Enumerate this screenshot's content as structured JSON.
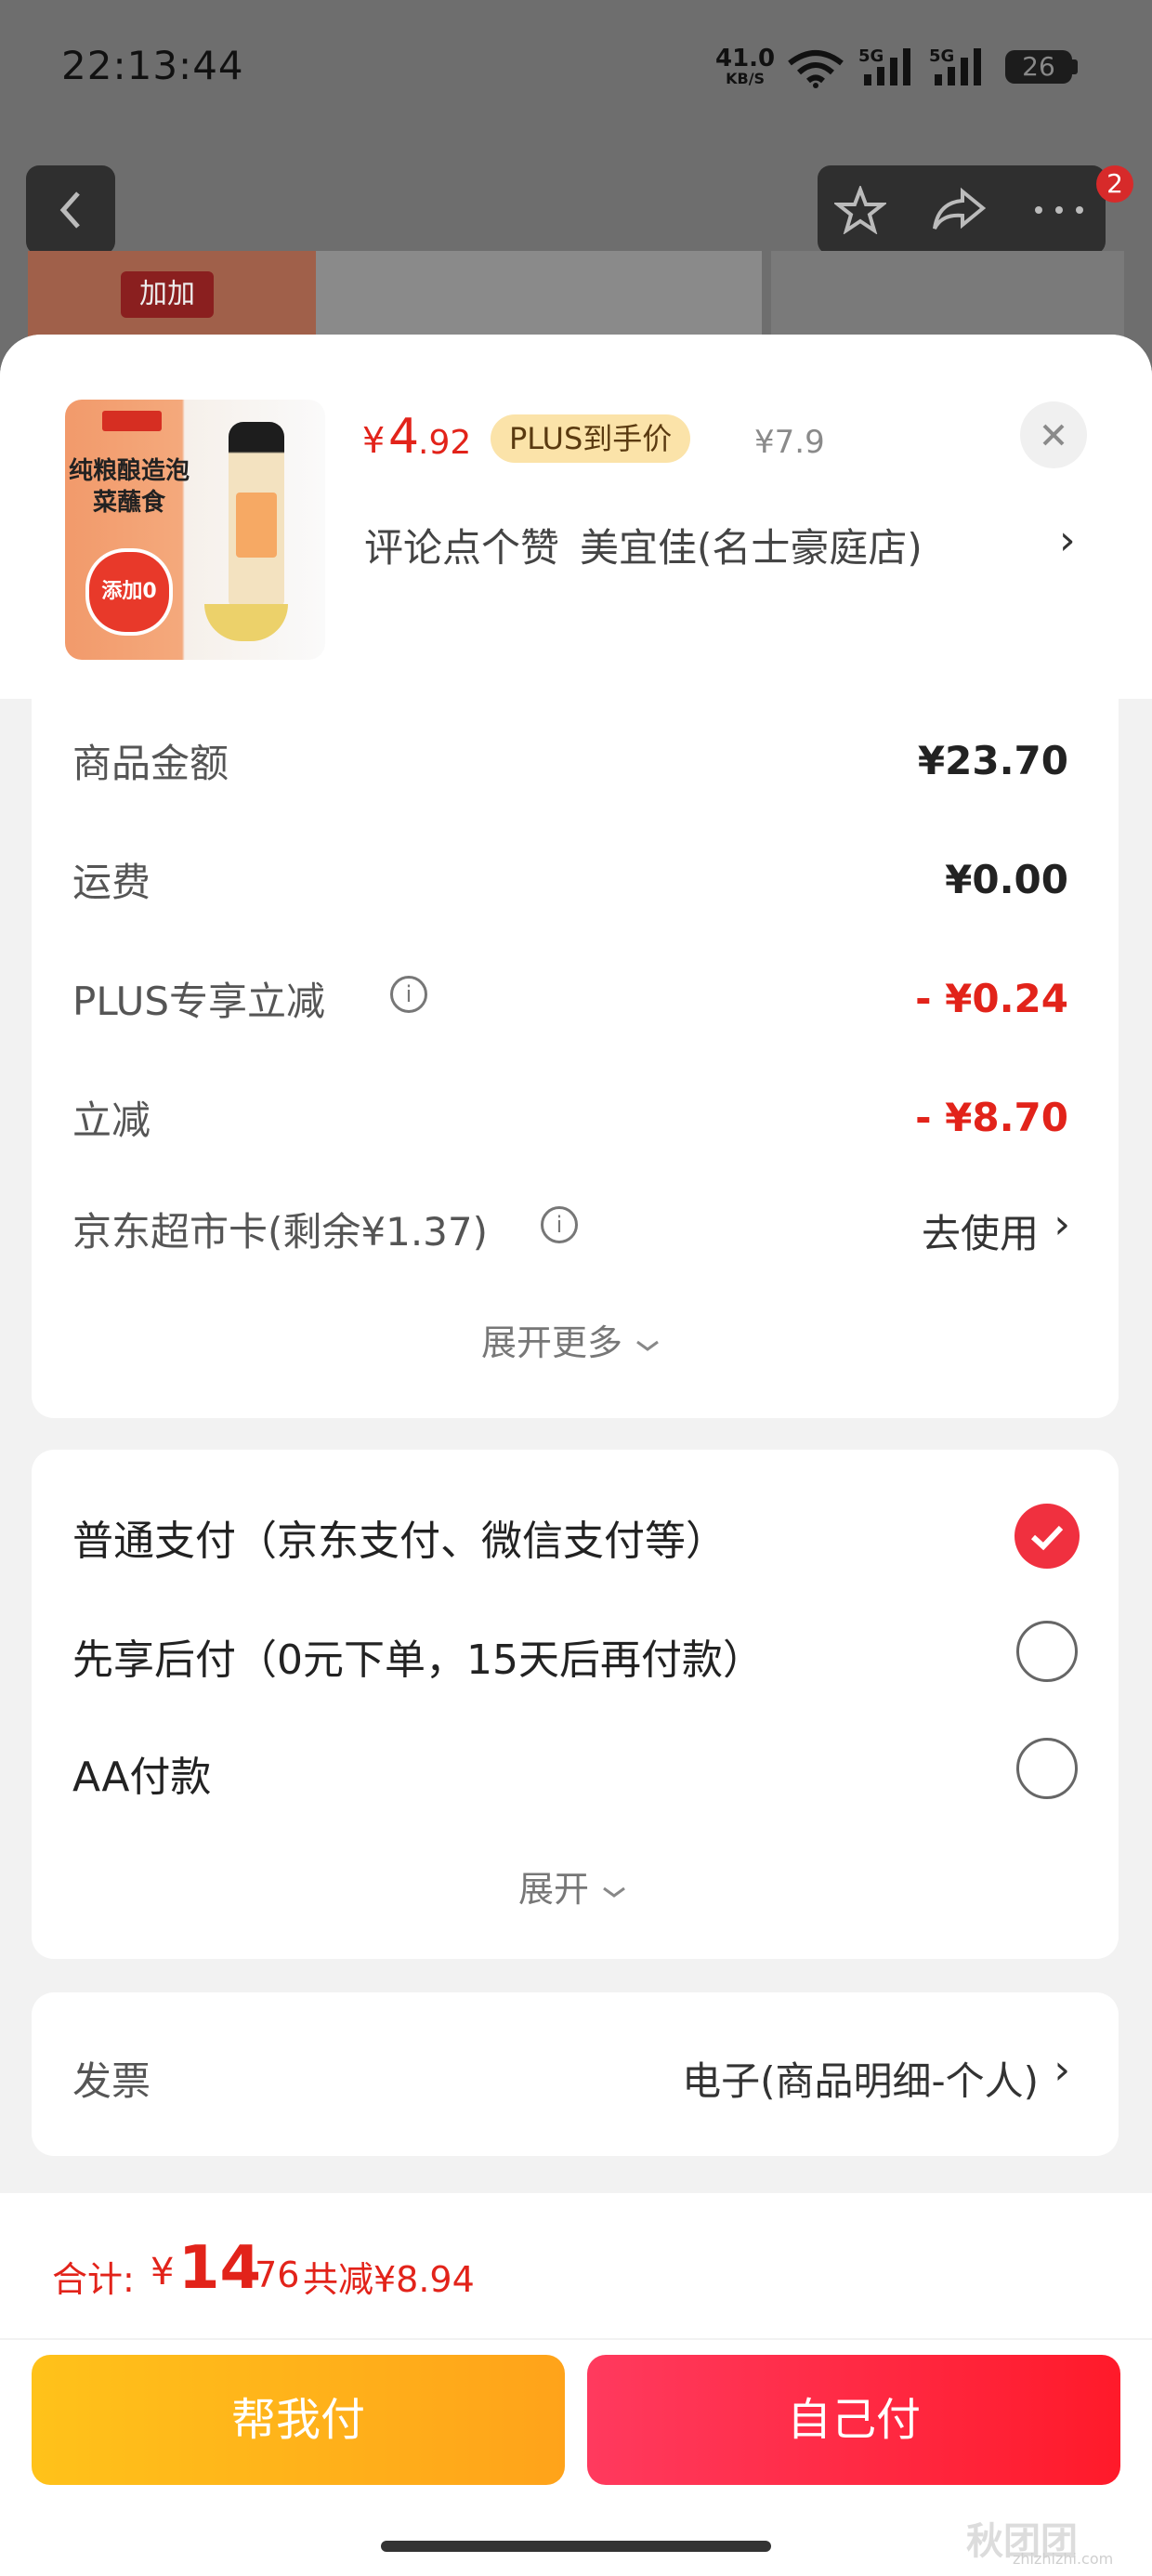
{
  "status_bar": {
    "time": "22:13:44",
    "speed_value": "41.0",
    "speed_unit": "KB/S",
    "battery": "26"
  },
  "background_page": {
    "notification_count": "2",
    "brand_logo": "加加"
  },
  "product": {
    "price_symbol": "¥",
    "price_integer": "4",
    "price_decimal": ".92",
    "plus_tag": "PLUS到手价",
    "original_price": "¥7.9",
    "review_text": "评论点个赞",
    "store_name": "美宜佳(名士豪庭店)",
    "thumb_brand": "加加",
    "thumb_title": "纯粮酿造泡菜蘸食",
    "thumb_badge": "添加0"
  },
  "fees": {
    "rows": [
      {
        "label": "商品金额",
        "value": "¥23.70"
      },
      {
        "label": "运费",
        "value": "¥0.00"
      },
      {
        "label": "PLUS专享立减",
        "value": "- ¥0.24"
      },
      {
        "label": "立减",
        "value": "- ¥8.70"
      },
      {
        "label": "京东超市卡(剩余¥1.37)",
        "value": "去使用"
      }
    ],
    "expand_more": "展开更多"
  },
  "payment": {
    "options": [
      {
        "label": "普通支付（京东支付、微信支付等）",
        "selected": true
      },
      {
        "label": "先享后付（0元下单，15天后再付款）",
        "selected": false
      },
      {
        "label": "AA付款",
        "selected": false
      }
    ],
    "expand": "展开"
  },
  "invoice": {
    "label": "发票",
    "value": "电子(商品明细-个人)"
  },
  "summary": {
    "total_label": "合计:",
    "total_symbol": "¥",
    "total_integer": "14",
    "total_decimal": ".76",
    "saved": "共减¥8.94"
  },
  "actions": {
    "help_pay": "帮我付",
    "self_pay": "自己付"
  },
  "watermark": {
    "text": "秋团团",
    "site": "zhizhizhi.com"
  },
  "colors": {
    "accent_red": "#e2231a",
    "help_button": "#ffb31a",
    "self_button": "#ff2a44",
    "plus_tag_bg": "#fbe3a9"
  }
}
